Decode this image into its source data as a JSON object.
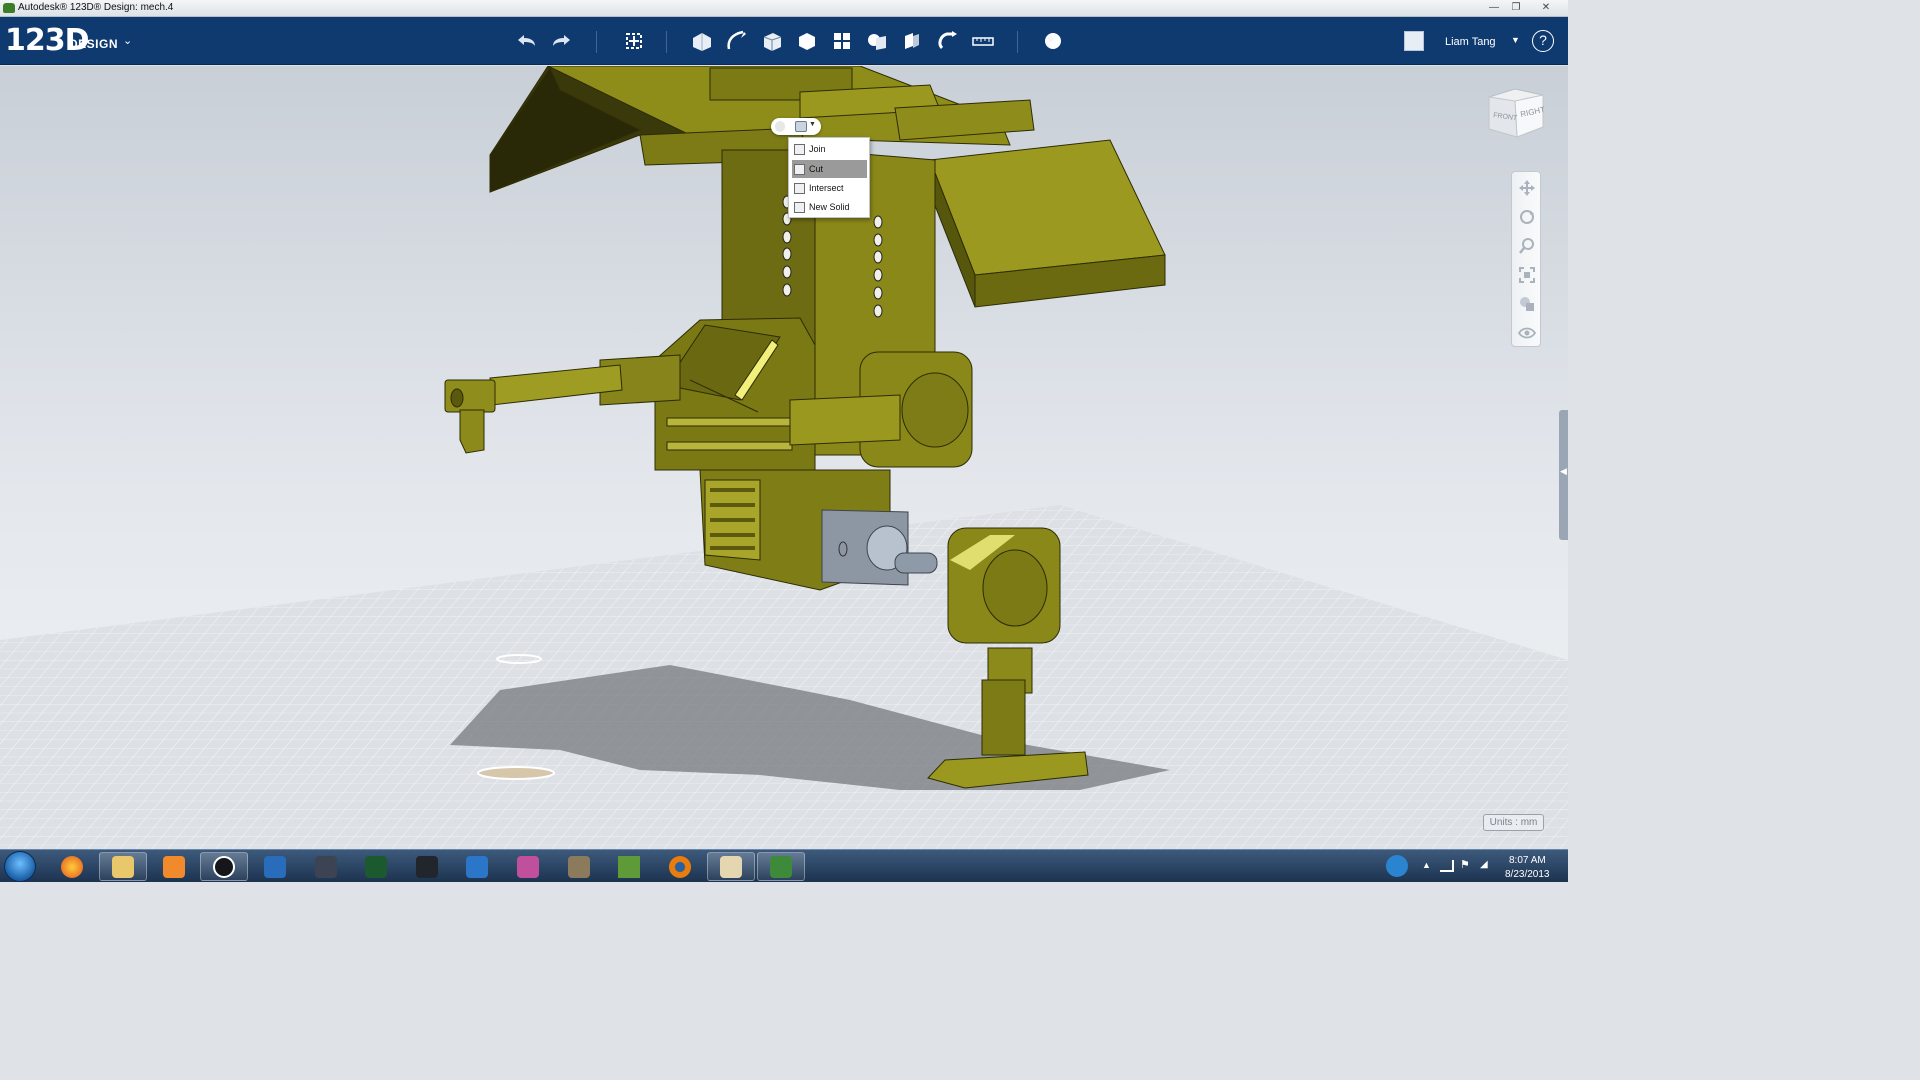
{
  "window": {
    "title": "Autodesk® 123D® Design: mech.4",
    "controls": [
      "minimize-icon",
      "restore-icon",
      "close-icon"
    ]
  },
  "appbar": {
    "logo_main": "123D",
    "logo_sub": "DESIGN",
    "tools": [
      "undo-icon",
      "redo-icon",
      "transform-icon",
      "primitives-icon",
      "sketch-icon",
      "construct-icon",
      "modify-icon",
      "pattern-icon",
      "grouping-icon",
      "combine-icon",
      "snap-icon",
      "measure-icon",
      "material-icon"
    ],
    "user_name": "Liam Tang",
    "help": "?"
  },
  "combine_menu": {
    "items": [
      {
        "label": "Join",
        "icon": "join-icon"
      },
      {
        "label": "Cut",
        "icon": "cut-icon",
        "selected": true
      },
      {
        "label": "Intersect",
        "icon": "intersect-icon"
      },
      {
        "label": "New Solid",
        "icon": "new-solid-icon"
      }
    ]
  },
  "viewcube": {
    "front": "FRONT",
    "right": "RIGHT"
  },
  "navbar": [
    "pan-icon",
    "orbit-icon",
    "zoom-icon",
    "fit-icon",
    "view-mode-icon",
    "visibility-icon"
  ],
  "units_label": "Units : mm",
  "taskbar": {
    "apps": [
      "firefox-icon",
      "file-explorer-icon",
      "media-player-icon",
      "hp-icon",
      "tasks-icon",
      "inkscape-icon",
      "pen-tool-icon",
      "notepad-icon",
      "butterfly-app-icon",
      "paint-app-icon",
      "gimp-icon",
      "minecraft-icon",
      "blender-icon",
      "paint-icon",
      "autodesk-123d-icon"
    ],
    "time": "8:07 AM",
    "date": "8/23/2013"
  },
  "colors": {
    "appbar": "#0e3a70",
    "model_olive": "#8c8a1a",
    "grid_bg": "#dfe3e8",
    "menu_selected": "#9a9a9a"
  }
}
